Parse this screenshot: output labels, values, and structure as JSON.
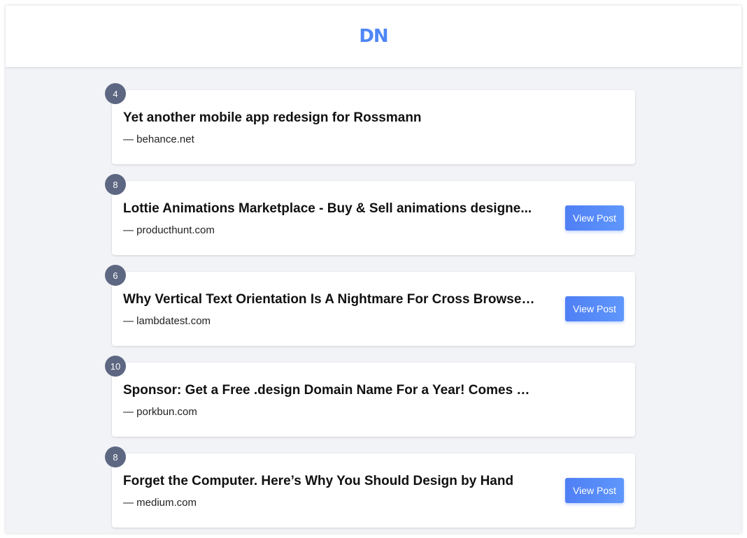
{
  "header": {
    "logo": "DN",
    "logo_color": "#4f86f7"
  },
  "posts": [
    {
      "votes": "4",
      "title": "Yet another mobile app redesign for Rossmann",
      "source": "— behance.net",
      "button": ""
    },
    {
      "votes": "8",
      "title": "Lottie Animations Marketplace - Buy & Sell animations designe...",
      "source": "— producthunt.com",
      "button": "View Post"
    },
    {
      "votes": "6",
      "title": "Why Vertical Text Orientation Is A Nightmare For Cross Browser ...",
      "source": "— lambdatest.com",
      "button": "View Post"
    },
    {
      "votes": "10",
      "title": "Sponsor: Get a Free .design Domain Name For a Year! Comes Wi...",
      "source": "— porkbun.com",
      "button": ""
    },
    {
      "votes": "8",
      "title": "Forget the Computer. Here’s Why You Should Design by Hand",
      "source": "— medium.com",
      "button": "View Post"
    }
  ],
  "colors": {
    "badge": "#5d6782",
    "button": "#4f7ff5",
    "background": "#f2f3f7"
  }
}
